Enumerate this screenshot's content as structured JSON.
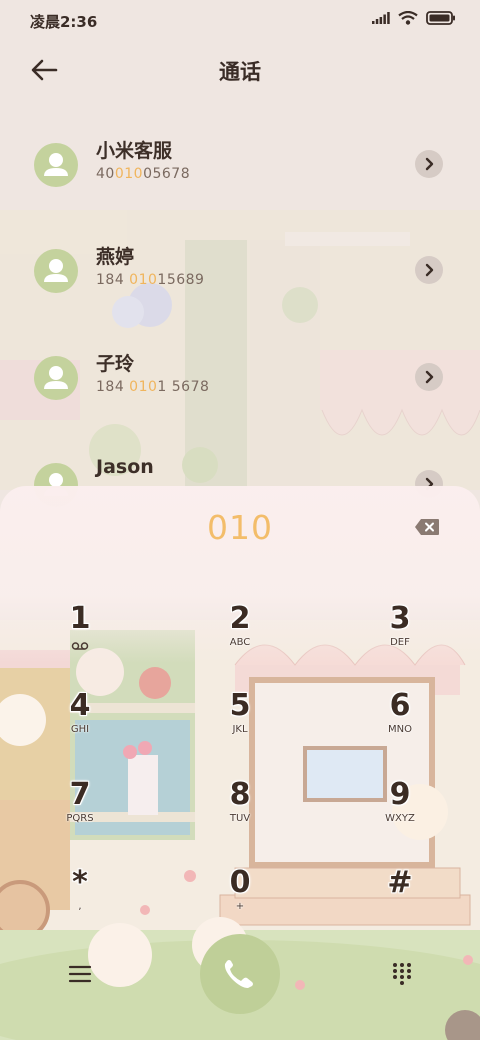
{
  "status_bar": {
    "time": "凌晨2:36",
    "icons": [
      "signal-icon",
      "wifi-icon",
      "battery-icon"
    ]
  },
  "header": {
    "title": "通话",
    "back_icon": "arrow-left-icon"
  },
  "contacts": [
    {
      "name": "小米客服",
      "number_parts": [
        "40",
        "010",
        "05678"
      ]
    },
    {
      "name": "燕婷",
      "number_parts": [
        "184 ",
        "010",
        "15689"
      ]
    },
    {
      "name": "子玲",
      "number_parts": [
        "184 ",
        "010",
        "1 5678"
      ]
    },
    {
      "name": "Jason",
      "number_parts": [
        "",
        "",
        ""
      ]
    }
  ],
  "dialer": {
    "input_value": "010",
    "keys": [
      {
        "digit": "1",
        "letters": ""
      },
      {
        "digit": "2",
        "letters": "ABC"
      },
      {
        "digit": "3",
        "letters": "DEF"
      },
      {
        "digit": "4",
        "letters": "GHI"
      },
      {
        "digit": "5",
        "letters": "JKL"
      },
      {
        "digit": "6",
        "letters": "MNO"
      },
      {
        "digit": "7",
        "letters": "PQRS"
      },
      {
        "digit": "8",
        "letters": "TUV"
      },
      {
        "digit": "9",
        "letters": "WXYZ"
      },
      {
        "digit": "*",
        "letters": ","
      },
      {
        "digit": "0",
        "letters": "+"
      },
      {
        "digit": "#",
        "letters": ""
      }
    ]
  },
  "colors": {
    "accent": "#f3bd6a",
    "avatar": "#c4d29d",
    "call_button": "#bfcf98"
  }
}
